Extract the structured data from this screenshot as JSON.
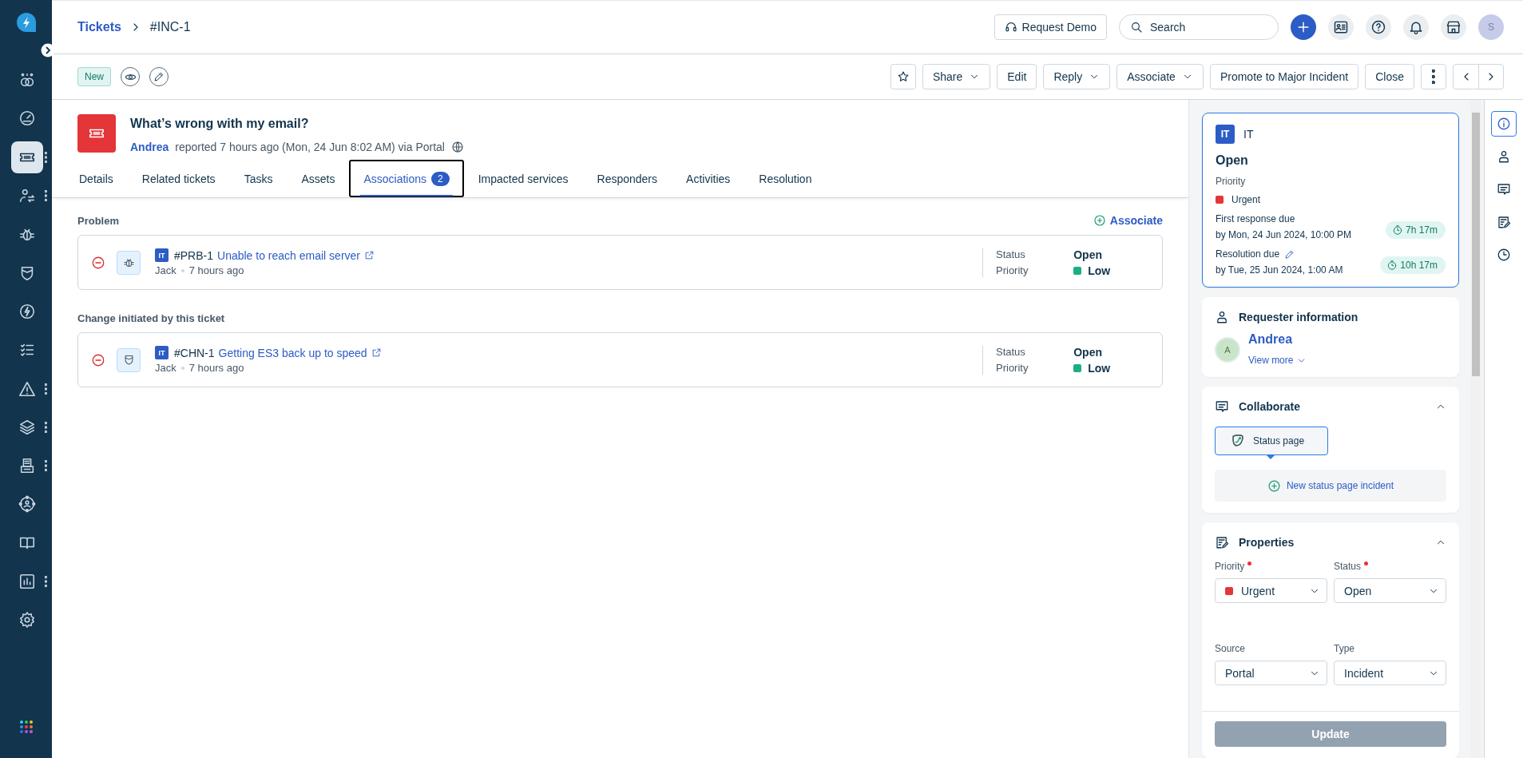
{
  "sidebar": {
    "items": [
      {
        "kind": "linked",
        "selected": false,
        "has_menu": false
      },
      {
        "kind": "gauge",
        "selected": false,
        "has_menu": false
      },
      {
        "kind": "ticket",
        "selected": true,
        "has_menu": true
      },
      {
        "kind": "personswap",
        "selected": false,
        "has_menu": true
      },
      {
        "kind": "bug",
        "selected": false,
        "has_menu": false
      },
      {
        "kind": "shield",
        "selected": false,
        "has_menu": false
      },
      {
        "kind": "boltcircle",
        "selected": false,
        "has_menu": false
      },
      {
        "kind": "checklist",
        "selected": false,
        "has_menu": false
      },
      {
        "kind": "warning",
        "selected": false,
        "has_menu": true
      },
      {
        "kind": "layers",
        "selected": false,
        "has_menu": true
      },
      {
        "kind": "doctray",
        "selected": false,
        "has_menu": true
      },
      {
        "kind": "orbit",
        "selected": false,
        "has_menu": false
      },
      {
        "kind": "book",
        "selected": false,
        "has_menu": false
      },
      {
        "kind": "chart",
        "selected": false,
        "has_menu": true
      },
      {
        "kind": "settings",
        "selected": false,
        "has_menu": false
      }
    ]
  },
  "topbar": {
    "breadcrumb": [
      {
        "label": "Tickets",
        "link": true
      },
      {
        "label": "#INC-1",
        "link": false
      }
    ],
    "request_demo": "Request Demo",
    "search": {
      "placeholder": "Search"
    },
    "avatar": "S"
  },
  "toolbar": {
    "status_tag": "New",
    "buttons": [
      {
        "label": "Share",
        "dropdown": true
      },
      {
        "label": "Edit",
        "dropdown": false
      },
      {
        "label": "Reply",
        "dropdown": true
      },
      {
        "label": "Associate",
        "dropdown": true
      },
      {
        "label": "Promote to Major Incident",
        "dropdown": false
      },
      {
        "label": "Close",
        "dropdown": false
      }
    ]
  },
  "ticket": {
    "title": "What’s wrong with my email?",
    "requester": "Andrea",
    "meta": "reported 7 hours ago (Mon, 24 Jun 8:02 AM) via Portal"
  },
  "tabs": [
    {
      "label": "Details",
      "selected": false
    },
    {
      "label": "Related tickets",
      "selected": false
    },
    {
      "label": "Tasks",
      "selected": false
    },
    {
      "label": "Assets",
      "selected": false
    },
    {
      "label": "Associations",
      "selected": true,
      "count": "2"
    },
    {
      "label": "Impacted services",
      "selected": false
    },
    {
      "label": "Responders",
      "selected": false
    },
    {
      "label": "Activities",
      "selected": false
    },
    {
      "label": "Resolution",
      "selected": false
    }
  ],
  "associations": {
    "associate_action": "Associate",
    "sections": [
      {
        "heading": "Problem",
        "items": [
          {
            "kind": "problem",
            "workspace": "IT",
            "id": "#PRB-1",
            "title": "Unable to reach email server",
            "author": "Jack",
            "time": "7 hours ago",
            "status_label": "Status",
            "status": "Open",
            "priority_label": "Priority",
            "priority": "Low",
            "color": "#1aae84"
          }
        ]
      },
      {
        "heading": "Change initiated by this ticket",
        "items": [
          {
            "kind": "change",
            "workspace": "IT",
            "id": "#CHN-1",
            "title": "Getting ES3 back up to speed",
            "author": "Jack",
            "time": "7 hours ago",
            "status_label": "Status",
            "status": "Open",
            "priority_label": "Priority",
            "priority": "Low",
            "color": "#1aae84"
          }
        ]
      }
    ]
  },
  "summary": {
    "workspace_badge": "IT",
    "workspace": "IT",
    "status": "Open",
    "priority_label": "Priority",
    "priority": {
      "label": "Urgent",
      "color": "#e43538"
    },
    "sla": [
      {
        "label": "First response due",
        "due": "by Mon, 24 Jun 2024, 10:00 PM",
        "timer": "7h 17m",
        "editable": false
      },
      {
        "label": "Resolution due",
        "due": "by Tue, 25 Jun 2024, 1:00 AM",
        "timer": "10h 17m",
        "editable": true
      }
    ]
  },
  "requester": {
    "heading": "Requester information",
    "avatar": "A",
    "name": "Andrea",
    "view_more": "View more"
  },
  "collaborate": {
    "heading": "Collaborate",
    "expanded": true,
    "tool": "Status page",
    "action": "New status page incident"
  },
  "properties": {
    "heading": "Properties",
    "expanded": true,
    "fields": [
      {
        "label": "Priority",
        "required": true,
        "value": "Urgent",
        "color": "#e43538"
      },
      {
        "label": "Status",
        "required": true,
        "value": "Open"
      },
      {
        "label": "Source",
        "required": false,
        "value": "Portal"
      },
      {
        "label": "Type",
        "required": false,
        "value": "Incident"
      }
    ],
    "update_button": {
      "label": "Update",
      "disabled": true
    }
  },
  "rail": [
    {
      "kind": "info",
      "selected": true
    },
    {
      "kind": "person",
      "selected": false
    },
    {
      "kind": "chat",
      "selected": false
    },
    {
      "kind": "notes",
      "selected": false
    },
    {
      "kind": "clock",
      "selected": false
    }
  ]
}
